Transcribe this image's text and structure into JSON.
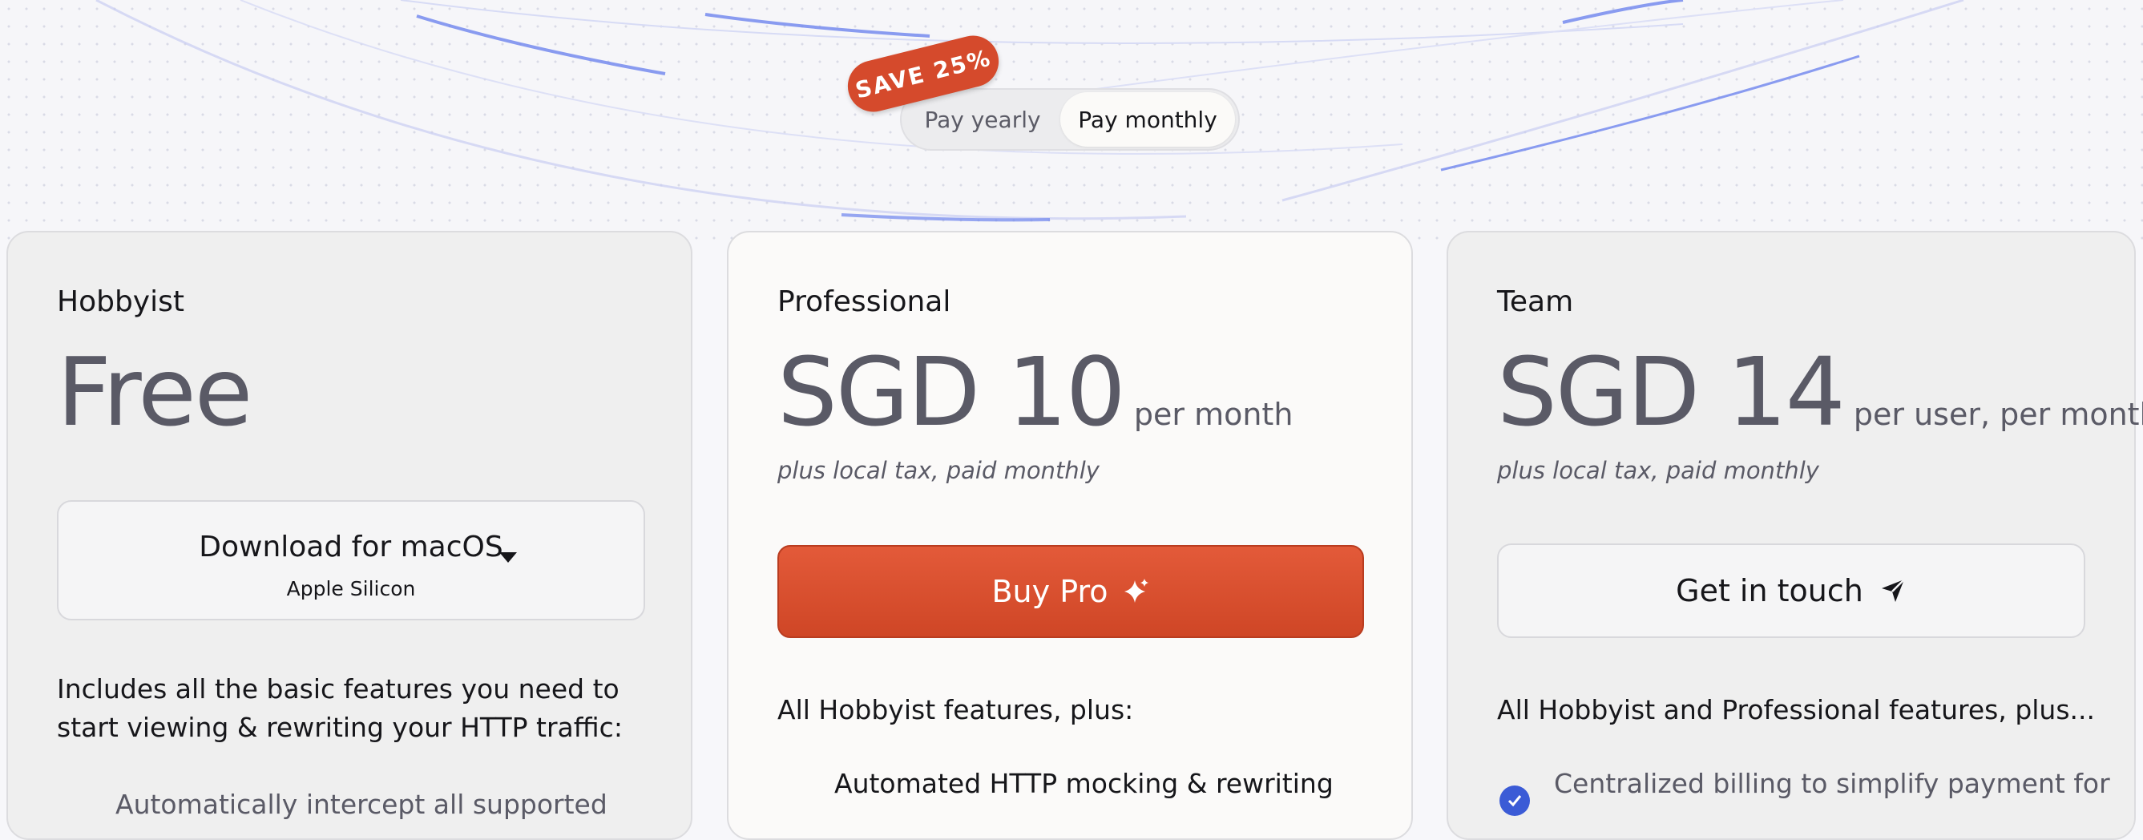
{
  "billing_toggle": {
    "save_badge": "SAVE 25%",
    "yearly_label": "Pay yearly",
    "monthly_label": "Pay monthly",
    "selected": "monthly"
  },
  "plans": [
    {
      "name": "Hobbyist",
      "price": "Free",
      "button": {
        "label": "Download for macOS",
        "sublabel": "Apple Silicon"
      },
      "features_intro": "Includes all the basic features you need to start viewing & rewriting your HTTP traffic:",
      "first_feature": "Automatically intercept all supported"
    },
    {
      "name": "Professional",
      "price": "SGD 10",
      "period": "per month",
      "tax_note": "plus local tax, paid monthly",
      "button": {
        "label": "Buy Pro"
      },
      "features_intro": "All Hobbyist features, plus:",
      "first_feature": "Automated HTTP mocking & rewriting"
    },
    {
      "name": "Team",
      "price": "SGD 14",
      "period": "per user, per month",
      "tax_note": "plus local tax, paid monthly",
      "button": {
        "label": "Get in touch"
      },
      "features_intro": "All Hobbyist and Professional features, plus...",
      "first_feature": "Centralized billing to simplify payment for"
    }
  ],
  "colors": {
    "accent": "#d54a2c",
    "check": "#3b5bd6",
    "price_text": "#5a5a66"
  },
  "icons": [
    "caret-down-icon",
    "sparkle-icon",
    "send-icon",
    "check-icon"
  ]
}
